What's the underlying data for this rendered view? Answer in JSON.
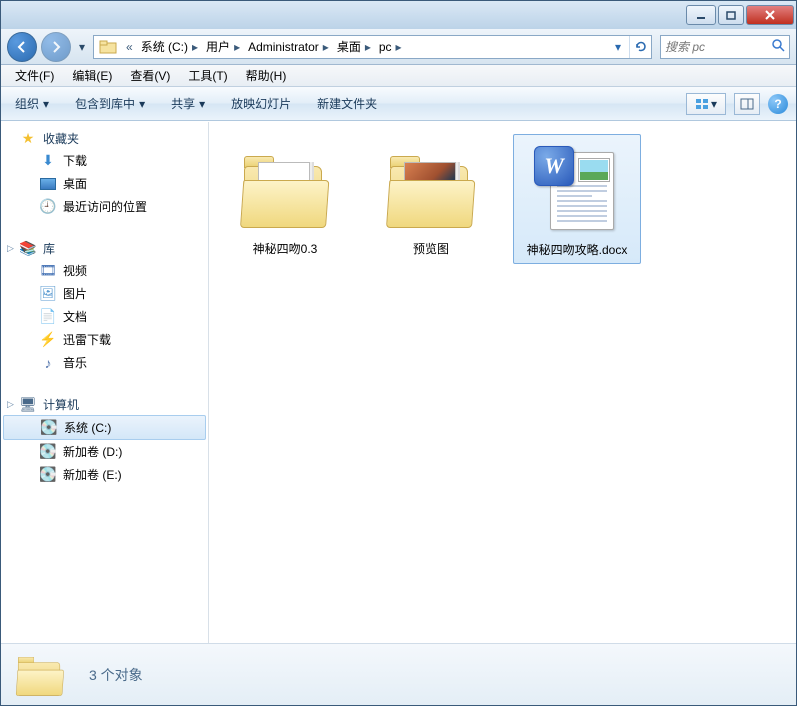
{
  "titlebar": {},
  "nav": {
    "crumbs": [
      "系统 (C:)",
      "用户",
      "Administrator",
      "桌面",
      "pc"
    ],
    "search_placeholder": "搜索 pc"
  },
  "menu": {
    "file": "文件(F)",
    "edit": "编辑(E)",
    "view": "查看(V)",
    "tools": "工具(T)",
    "help": "帮助(H)"
  },
  "toolbar": {
    "organize": "组织",
    "include": "包含到库中",
    "share": "共享",
    "slideshow": "放映幻灯片",
    "newfolder": "新建文件夹"
  },
  "sidebar": {
    "favorites": {
      "label": "收藏夹",
      "items": [
        "下载",
        "桌面",
        "最近访问的位置"
      ]
    },
    "libraries": {
      "label": "库",
      "items": [
        "视频",
        "图片",
        "文档",
        "迅雷下载",
        "音乐"
      ]
    },
    "computer": {
      "label": "计算机",
      "items": [
        "系统 (C:)",
        "新加卷 (D:)",
        "新加卷 (E:)"
      ]
    }
  },
  "files": [
    {
      "name": "神秘四吻0.3",
      "type": "folder"
    },
    {
      "name": "预览图",
      "type": "folder-preview"
    },
    {
      "name": "神秘四吻攻略.docx",
      "type": "docx",
      "selected": true
    }
  ],
  "status": {
    "text": "3 个对象"
  }
}
